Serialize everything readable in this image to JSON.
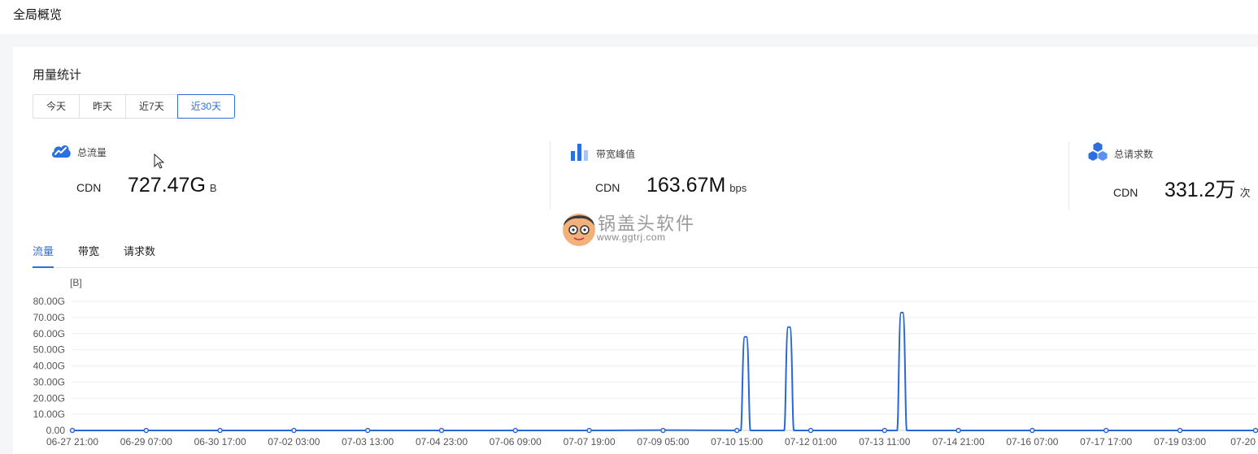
{
  "page": {
    "title": "全局概览"
  },
  "usage": {
    "title": "用量统计",
    "ranges": [
      "今天",
      "昨天",
      "近7天",
      "近30天"
    ],
    "active_range": "近30天"
  },
  "metrics": [
    {
      "label": "总流量",
      "icon": "traffic-cloud-icon",
      "cdn": "CDN",
      "value": "727.47G",
      "unit": "B"
    },
    {
      "label": "带宽峰值",
      "icon": "bandwidth-bars-icon",
      "cdn": "CDN",
      "value": "163.67M",
      "unit": "bps"
    },
    {
      "label": "总请求数",
      "icon": "requests-cubes-icon",
      "cdn": "CDN",
      "value": "331.2万",
      "unit": "次"
    }
  ],
  "watermark": {
    "text": "锅盖头软件",
    "url": "www.ggtrj.com"
  },
  "tabs": [
    "流量",
    "带宽",
    "请求数"
  ],
  "active_tab": "流量",
  "colors": {
    "accent": "#2f6fd6",
    "line": "#2a67d3"
  },
  "chart_data": {
    "type": "line",
    "unit_label": "[B]",
    "y_ticks": [
      "0.00",
      "10.00G",
      "20.00G",
      "30.00G",
      "40.00G",
      "50.00G",
      "60.00G",
      "70.00G",
      "80.00G"
    ],
    "ylim": [
      0,
      80
    ],
    "x_ticks": [
      "06-27 21:00",
      "06-29 07:00",
      "06-30 17:00",
      "07-02 03:00",
      "07-03 13:00",
      "07-04 23:00",
      "07-06 09:00",
      "07-07 19:00",
      "07-09 05:00",
      "07-10 15:00",
      "07-12 01:00",
      "07-13 11:00",
      "07-14 21:00",
      "07-16 07:00",
      "07-17 17:00",
      "07-19 03:00",
      "07-20"
    ],
    "grid": true,
    "series": [
      {
        "points": [
          [
            "06-27 21:00",
            0
          ],
          [
            "06-29 07:00",
            0
          ],
          [
            "06-30 17:00",
            0
          ],
          [
            "07-02 03:00",
            0
          ],
          [
            "07-03 13:00",
            0
          ],
          [
            "07-04 23:00",
            0
          ],
          [
            "07-06 09:00",
            0
          ],
          [
            "07-07 19:00",
            0
          ],
          [
            "07-09 05:00",
            0.2
          ],
          [
            "07-10 15:00",
            0
          ],
          [
            "07-10 19:00",
            58
          ],
          [
            "07-12 01:00",
            0
          ],
          [
            "07-11 15:00",
            64
          ],
          [
            "07-13 11:00",
            0
          ],
          [
            "07-13 19:00",
            73
          ],
          [
            "07-14 21:00",
            0
          ],
          [
            "07-16 07:00",
            0
          ],
          [
            "07-17 17:00",
            0
          ],
          [
            "07-19 03:00",
            0
          ],
          [
            "07-20",
            0
          ]
        ]
      }
    ]
  }
}
